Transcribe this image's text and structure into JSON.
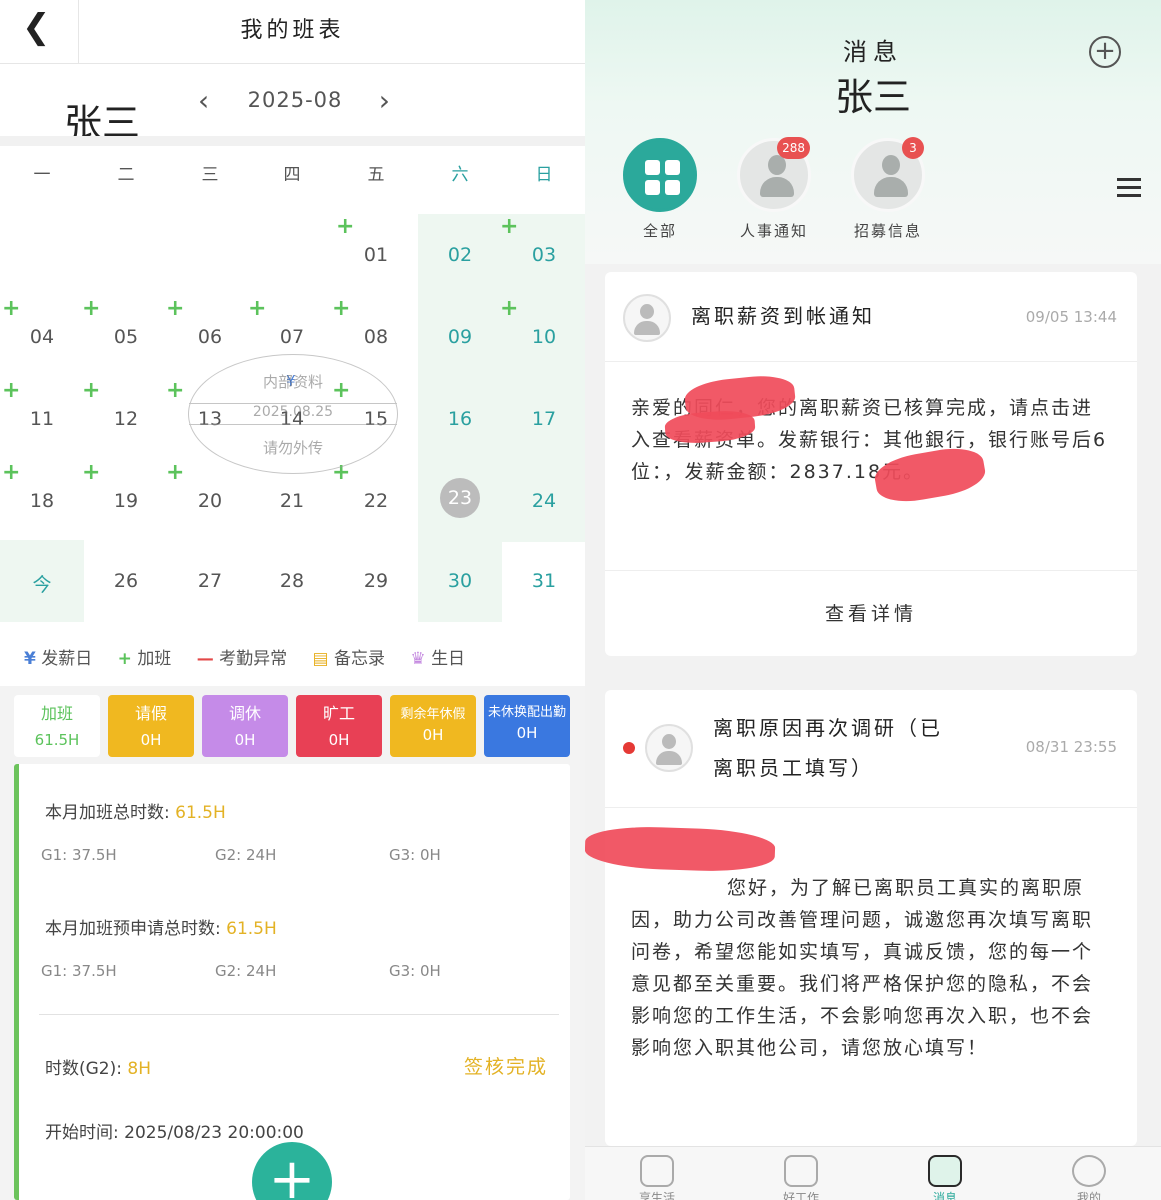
{
  "left": {
    "title": "我的班表",
    "user_name": "张三",
    "month": "2025-08",
    "weekdays": [
      "一",
      "二",
      "三",
      "四",
      "五",
      "六",
      "日"
    ],
    "calendar": {
      "rows": [
        [
          "",
          "",
          "",
          "",
          "01",
          "02",
          "03"
        ],
        [
          "04",
          "05",
          "06",
          "07",
          "08",
          "09",
          "10"
        ],
        [
          "11",
          "12",
          "13",
          "14",
          "15",
          "16",
          "17"
        ],
        [
          "18",
          "19",
          "20",
          "21",
          "22",
          "23",
          "24"
        ],
        [
          "今",
          "26",
          "27",
          "28",
          "29",
          "30",
          "31"
        ]
      ],
      "today": "23"
    },
    "stamp": {
      "line1": "内部资料",
      "line2": "2025.08.25",
      "line3": "请勿外传"
    },
    "legend": {
      "payday": "发薪日",
      "overtime": "加班",
      "abnormal": "考勤异常",
      "memo": "备忘录",
      "birthday": "生日"
    },
    "tiles": [
      {
        "label": "加班",
        "value": "61.5H",
        "color": "#ffffff"
      },
      {
        "label": "请假",
        "value": "0H",
        "color": "#f0b820"
      },
      {
        "label": "调休",
        "value": "0H",
        "color": "#c58be8"
      },
      {
        "label": "旷工",
        "value": "0H",
        "color": "#e84055"
      },
      {
        "label": "剩余年休假",
        "value": "0H",
        "color": "#f0b820"
      },
      {
        "label": "未休换配出勤",
        "value": "0H",
        "color": "#3a78e0"
      }
    ],
    "overtime_card": {
      "total_label": "本月加班总时数:",
      "total_value": "61.5H",
      "g1": "G1: 37.5H",
      "g2": "G2: 24H",
      "g3": "G3: 0H",
      "apply_label": "本月加班预申请总时数:",
      "apply_value": "61.5H",
      "apply_g1": "G1: 37.5H",
      "apply_g2": "G2: 24H",
      "apply_g3": "G3: 0H",
      "hours_label": "时数(G2):",
      "hours_value": "8H",
      "status": "签核完成",
      "start_time": "开始时间: 2025/08/23 20:00:00"
    }
  },
  "right": {
    "title": "消息",
    "user_name": "张三",
    "categories": [
      {
        "label": "全部",
        "badge": ""
      },
      {
        "label": "人事通知",
        "badge": "288"
      },
      {
        "label": "招募信息",
        "badge": "3"
      }
    ],
    "messages": [
      {
        "title": "离职薪资到帐通知",
        "time": "09/05 13:44",
        "body": "亲爱的同仁，您的离职薪资已核算完成，请点击进入查看薪资单。发薪银行：其他銀行，银行账号后6位：，发薪金额：2837.18元。",
        "link": "查看详情"
      },
      {
        "title_line1": "离职原因再次调研（已",
        "title_line2": "离职员工填写）",
        "time": "08/31 23:55",
        "body": "您好，为了解已离职员工真实的离职原因，助力公司改善管理问题，诚邀您再次填写离职问卷，希望您能如实填写，真诚反馈，您的每一个意见都至关重要。我们将严格保护您的隐私，不会影响您的工作生活，不会影响您再次入职，也不会影响您入职其他公司，请您放心填写！"
      }
    ],
    "tabs": [
      {
        "label": "享生活"
      },
      {
        "label": "好工作"
      },
      {
        "label": "消息"
      },
      {
        "label": "我的"
      }
    ]
  }
}
